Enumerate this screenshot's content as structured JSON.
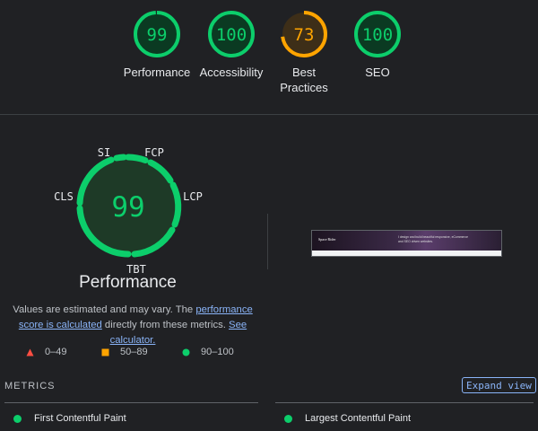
{
  "colors": {
    "pass": "#0cce6b",
    "average": "#ffa400",
    "fail": "#ff4e42",
    "link": "#8ab4f8",
    "background": "#202124"
  },
  "categories": [
    {
      "score": 99,
      "label": "Performance",
      "status": "pass"
    },
    {
      "score": 100,
      "label": "Accessibility",
      "status": "pass"
    },
    {
      "score": 73,
      "label": "Best Practices",
      "status": "average"
    },
    {
      "score": 100,
      "label": "SEO",
      "status": "pass"
    }
  ],
  "performance": {
    "score": 99,
    "title": "Performance",
    "metric_labels": {
      "si": "SI",
      "fcp": "FCP",
      "cls": "CLS",
      "lcp": "LCP",
      "tbt": "TBT"
    },
    "note_prefix": "Values are estimated and may vary. The ",
    "note_link_1": "performance score is calculated",
    "note_middle": " directly from these metrics. ",
    "note_link_2": "See calculator."
  },
  "legend": [
    {
      "shape": "triangle-icon",
      "range": "0–49"
    },
    {
      "shape": "square-icon",
      "range": "50–89"
    },
    {
      "shape": "circle-icon",
      "range": "90–100"
    }
  ],
  "screenshot": {
    "brand": "Space Rider",
    "tagline": "I design and build beautiful responsive, eCommerce and SEO driven websites."
  },
  "metrics": {
    "heading": "METRICS",
    "expand_label": "Expand view",
    "items": [
      {
        "label": "First Contentful Paint",
        "status": "pass"
      },
      {
        "label": "Largest Contentful Paint",
        "status": "pass"
      }
    ]
  }
}
